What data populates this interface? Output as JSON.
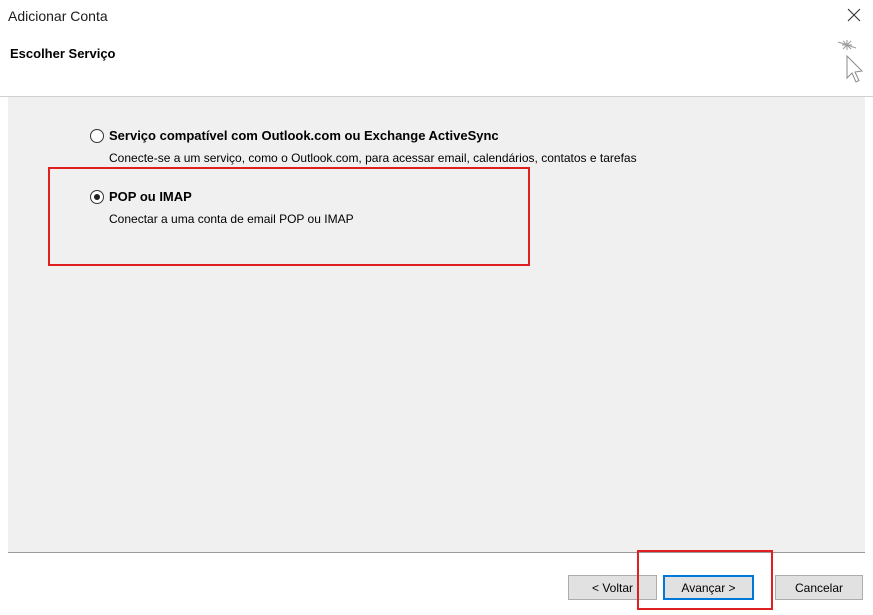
{
  "window": {
    "title": "Adicionar Conta",
    "close_icon": "close-icon"
  },
  "header": {
    "heading": "Escolher Serviço",
    "icon": "wizard-cursor-icon"
  },
  "options": [
    {
      "title": "Serviço compatível com Outlook.com ou Exchange ActiveSync",
      "description": "Conecte-se a um serviço, como o Outlook.com, para acessar email, calendários, contatos e tarefas",
      "selected": false
    },
    {
      "title": "POP ou IMAP",
      "description": "Conectar a uma conta de email POP ou IMAP",
      "selected": true
    }
  ],
  "footer": {
    "back_label": "< Voltar",
    "next_label": "Avançar >",
    "cancel_label": "Cancelar"
  },
  "colors": {
    "highlight": "#e02020",
    "content_bg": "#f0f0f0",
    "accent": "#0078d7"
  }
}
